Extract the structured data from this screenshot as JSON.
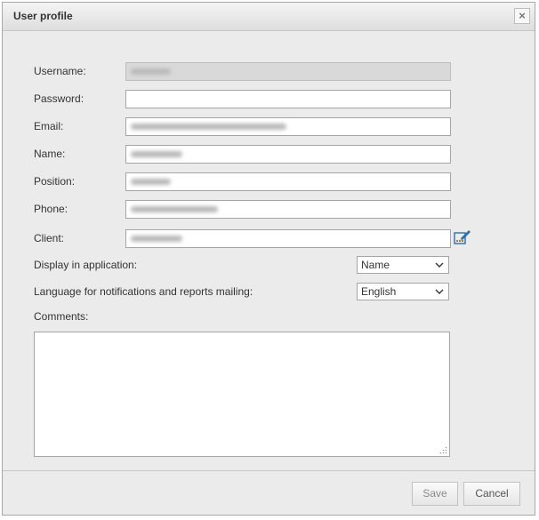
{
  "dialog": {
    "title": "User profile",
    "close_icon": "close-icon"
  },
  "form": {
    "username": {
      "label": "Username:",
      "value": ""
    },
    "password": {
      "label": "Password:",
      "value": ""
    },
    "email": {
      "label": "Email:",
      "value": ""
    },
    "name": {
      "label": "Name:",
      "value": ""
    },
    "position": {
      "label": "Position:",
      "value": ""
    },
    "phone": {
      "label": "Phone:",
      "value": ""
    },
    "client": {
      "label": "Client:",
      "value": "",
      "edit_icon": "edit-pencil-icon"
    },
    "display_in_application": {
      "label": "Display in application:",
      "selected": "Name"
    },
    "language": {
      "label": "Language for notifications and reports mailing:",
      "selected": "English"
    },
    "comments": {
      "label": "Comments:",
      "value": ""
    }
  },
  "footer": {
    "save_label": "Save",
    "cancel_label": "Cancel"
  },
  "colors": {
    "dialog_bg": "#ebebeb",
    "readonly_bg": "#d9d9d9",
    "edit_icon": "#2d6fa8"
  }
}
